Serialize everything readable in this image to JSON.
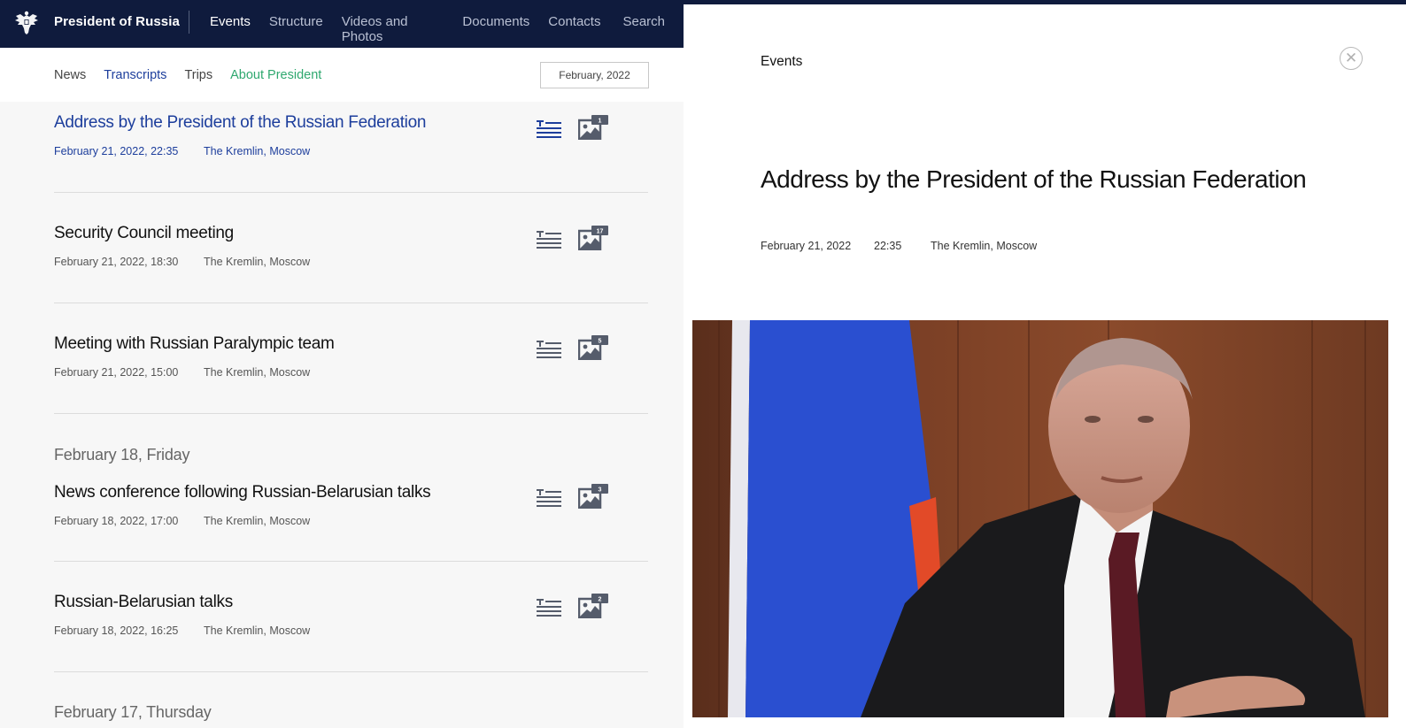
{
  "header": {
    "brand": "President of Russia",
    "nav": [
      "Events",
      "Structure",
      "Videos and Photos",
      "Documents",
      "Contacts",
      "Search"
    ]
  },
  "subnav": {
    "news": "News",
    "transcripts": "Transcripts",
    "trips": "Trips",
    "about": "About President",
    "date": "February, 2022"
  },
  "feed": {
    "items": [
      {
        "title": "Address by the President of the Russian Federation",
        "datetime": "February 21, 2022, 22:35",
        "place": "The Kremlin, Moscow",
        "photos": "1"
      },
      {
        "title": "Security Council meeting",
        "datetime": "February 21, 2022, 18:30",
        "place": "The Kremlin, Moscow",
        "photos": "17"
      },
      {
        "title": "Meeting with Russian Paralympic team",
        "datetime": "February 21, 2022, 15:00",
        "place": "The Kremlin, Moscow",
        "photos": "5"
      },
      {
        "title": "News conference following Russian-Belarusian talks",
        "datetime": "February 18, 2022, 17:00",
        "place": "The Kremlin, Moscow",
        "photos": "3"
      },
      {
        "title": "Russian-Belarusian talks",
        "datetime": "February 18, 2022, 16:25",
        "place": "The Kremlin, Moscow",
        "photos": "2"
      }
    ],
    "day_headers": [
      "February 18, Friday",
      "February 17, Thursday"
    ]
  },
  "detail": {
    "section": "Events",
    "close_glyph": "✕",
    "title": "Address by the President of the Russian Federation",
    "date": "February 21, 2022",
    "time": "22:35",
    "place": "The Kremlin, Moscow"
  },
  "colors": {
    "navy": "#0f1b3d",
    "link_blue": "#1d3e9c",
    "green": "#2fa86f"
  }
}
